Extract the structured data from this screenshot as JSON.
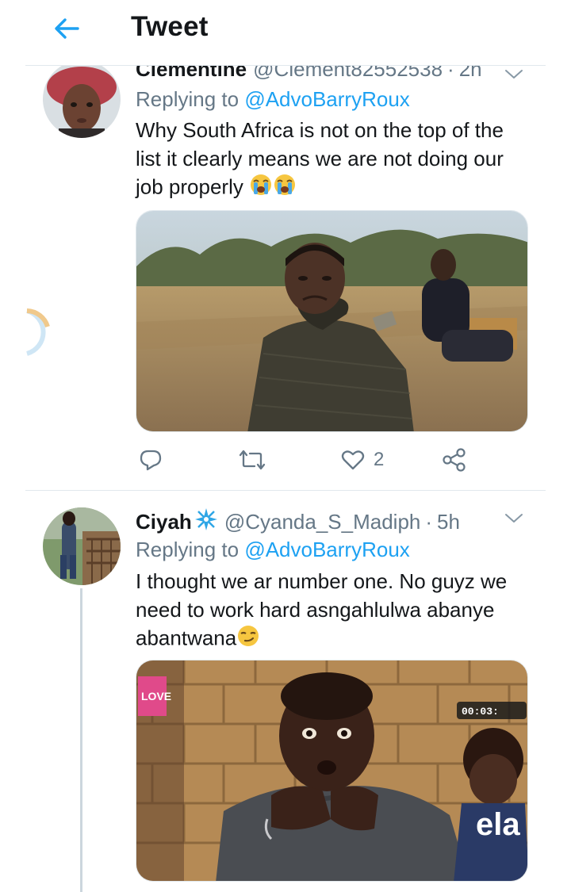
{
  "header": {
    "title": "Tweet"
  },
  "tweets": [
    {
      "name": "Clementine",
      "handle": "@Clement82552538",
      "time": "2h",
      "replying_prefix": "Replying to",
      "replying_to": "@AdvoBarryRoux",
      "text": "Why South Africa is not on the top of the list it clearly means we are not doing our job properly",
      "emojis": [
        "loudly-crying-face",
        "loudly-crying-face"
      ],
      "actions": {
        "reply_count": "",
        "retweet_count": "",
        "like_count": "2"
      }
    },
    {
      "name": "Ciyah",
      "badge_emoji": "sparkle",
      "handle": "@Cyanda_S_Madiph",
      "time": "5h",
      "replying_prefix": "Replying to",
      "replying_to": "@AdvoBarryRoux",
      "text": "I thought we ar number one. No guyz we need to work hard asngahlulwa abanye abantwana",
      "emojis": [
        "smirking-face"
      ],
      "media_overlay": {
        "timer": "00:03:",
        "logo_text": "ela",
        "channel_text": "LOVE"
      }
    }
  ],
  "colors": {
    "accent": "#1da1f2",
    "secondary_text": "#657786",
    "divider": "#e1e8ed"
  }
}
